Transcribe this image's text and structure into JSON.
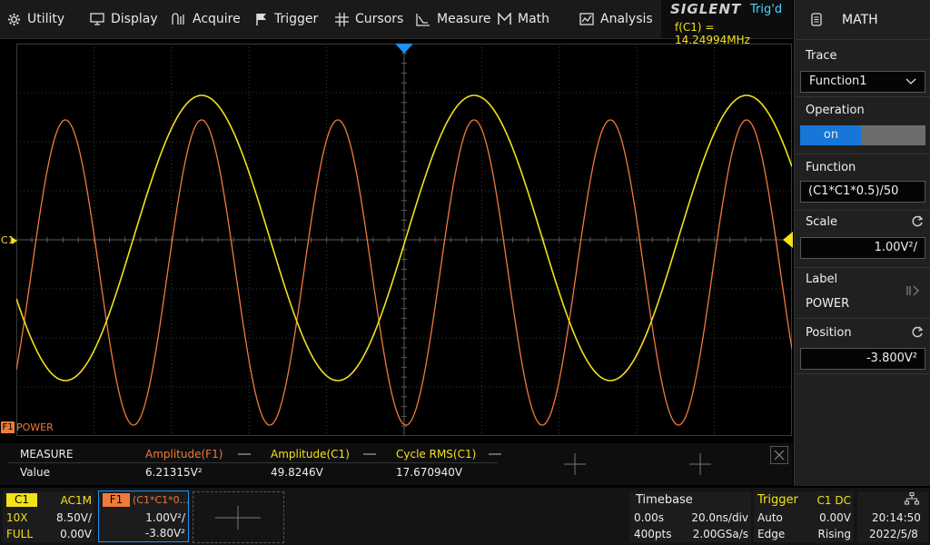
{
  "menu": {
    "utility": "Utility",
    "display": "Display",
    "acquire": "Acquire",
    "trigger": "Trigger",
    "cursors": "Cursors",
    "measure": "Measure",
    "math": "Math",
    "analysis": "Analysis"
  },
  "brand": {
    "logo": "SIGLENT",
    "trigger_status": "Trig'd",
    "frequency": "f(C1) = 14.24994MHz"
  },
  "math_panel": {
    "title": "MATH",
    "trace_label": "Trace",
    "trace_value": "Function1",
    "operation_label": "Operation",
    "operation_value": "on",
    "function_label": "Function",
    "function_value": "(C1*C1*0.5)/50",
    "scale_label": "Scale",
    "scale_value": "1.00V²/",
    "label_label": "Label",
    "label_value": "POWER",
    "position_label": "Position",
    "position_value": "-3.800V²"
  },
  "waveform": {
    "c1_marker": "C1",
    "f1_marker": "F1",
    "f1_label": "POWER"
  },
  "measure": {
    "title": "MEASURE",
    "row_label": "Value",
    "columns": [
      {
        "name": "Amplitude(F1)",
        "value": "6.21315V²",
        "color": "#f07a3a"
      },
      {
        "name": "Amplitude(C1)",
        "value": "49.8246V",
        "color": "#f3e11a"
      },
      {
        "name": "Cycle RMS(C1)",
        "value": "17.670940V",
        "color": "#f3e11a"
      }
    ]
  },
  "c1_box": {
    "name": "C1",
    "coupling": "AC1M",
    "probe": "10X",
    "scale": "8.50V/",
    "bandwidth": "FULL",
    "offset": "0.00V"
  },
  "f1_box": {
    "name": "F1",
    "expr": "(C1*C1*0...",
    "scale": "1.00V²/",
    "offset": "-3.80V²"
  },
  "timebase": {
    "title": "Timebase",
    "delay": "0.00s",
    "scale": "20.0ns/div",
    "points": "400pts",
    "rate": "2.00GSa/s"
  },
  "trigger": {
    "title": "Trigger",
    "source": "C1 DC",
    "mode": "Auto",
    "level": "0.00V",
    "type": "Edge",
    "slope": "Rising"
  },
  "clock": {
    "time": "20:14:50",
    "date": "2022/5/8"
  },
  "colors": {
    "c1": "#f3e11a",
    "f1": "#f07a3a",
    "accent": "#1777d8",
    "trigger_status": "#4dd4ff"
  }
}
